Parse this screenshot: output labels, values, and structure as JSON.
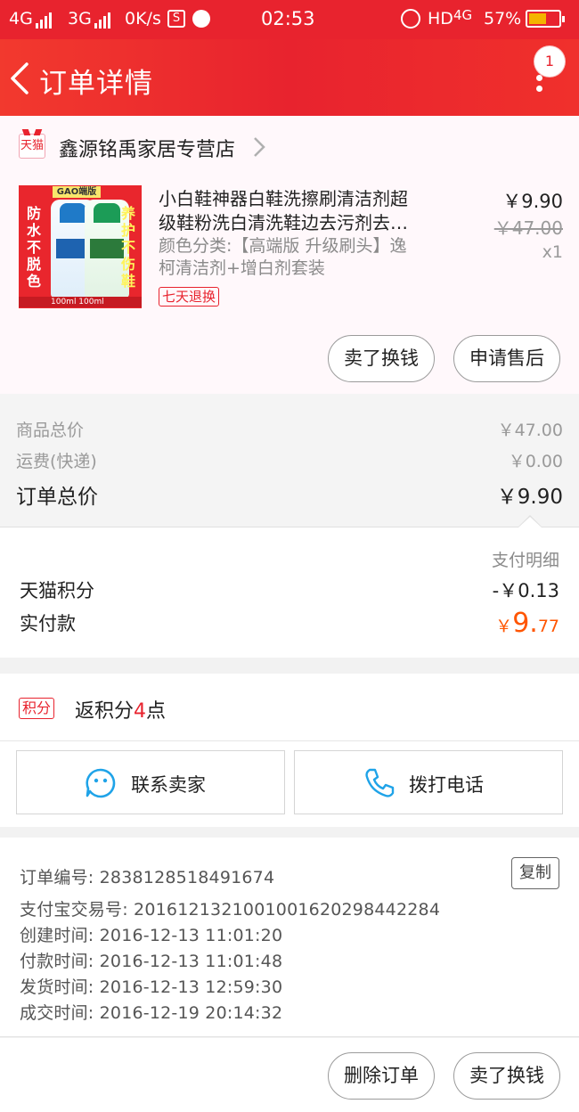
{
  "status_bar": {
    "network1": "4G",
    "network2": "3G",
    "speed": "0K/s",
    "time": "02:53",
    "hd": "HD",
    "network3": "4G",
    "battery": "57%"
  },
  "header": {
    "title": "订单详情",
    "badge": "1",
    "colors": {
      "bar": "#e8232e"
    }
  },
  "store": {
    "badge": "天猫",
    "name": "鑫源铭禹家居专营店"
  },
  "product": {
    "image_text": {
      "tag": "GAO端版",
      "left": "防水不脱色",
      "right": "养护不伤鞋",
      "volume": "100ml   100ml"
    },
    "title_line1": "小白鞋神器白鞋洗擦刷清洁剂超",
    "title_line2": "级鞋粉洗白清洗鞋边去污剂去…",
    "sku_line1": "颜色分类:【高端版 升级刷头】逸",
    "sku_line2": "柯清洁剂+增白剂套装",
    "return_tag": "七天退换",
    "price": "￥9.90",
    "original_price": "￥47.00",
    "quantity": "x1"
  },
  "actions": {
    "sell_exchange": "卖了换钱",
    "after_sale": "申请售后"
  },
  "totals": {
    "goods_label": "商品总价",
    "goods_value": "￥47.00",
    "shipping_label": "运费(快递)",
    "shipping_value": "￥0.00",
    "order_total_label": "订单总价",
    "order_total_value": "￥9.90"
  },
  "payment": {
    "detail_label": "支付明细",
    "points_label": "天猫积分",
    "points_value": "-￥0.13",
    "paid_label": "实付款",
    "paid_symbol": "￥",
    "paid_integer": "9.",
    "paid_decimal": "77",
    "colors": {
      "paid": "#ff5500"
    }
  },
  "rewards": {
    "tag": "积分",
    "prefix": "返积分",
    "points": "4",
    "suffix": "点"
  },
  "contact": {
    "seller_label": "联系卖家",
    "phone_label": "拨打电话",
    "colors": {
      "icon": "#1fa3e8"
    }
  },
  "order_info": {
    "order_no": "订单编号: 2838128518491674",
    "alipay_no": "支付宝交易号: 2016121321001001620298442284",
    "created": "创建时间: 2016-12-13 11:01:20",
    "paid": "付款时间: 2016-12-13 11:01:48",
    "shipped": "发货时间: 2016-12-13 12:59:30",
    "completed": "成交时间: 2016-12-19 20:14:32",
    "copy_label": "复制"
  },
  "bottom": {
    "delete_label": "删除订单",
    "sell_label": "卖了换钱"
  }
}
